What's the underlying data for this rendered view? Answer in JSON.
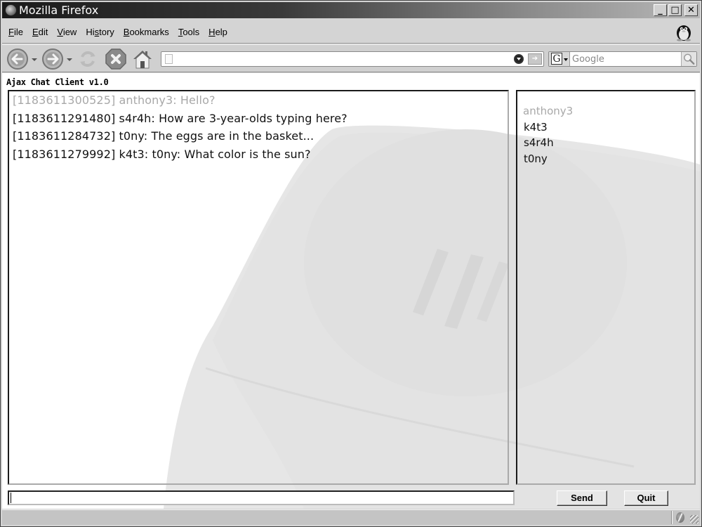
{
  "window": {
    "title": "Mozilla Firefox",
    "controls": {
      "minimize": "_",
      "maximize": "□",
      "close": "✕"
    }
  },
  "menubar": {
    "items": [
      {
        "label": "File",
        "accel": "F"
      },
      {
        "label": "Edit",
        "accel": "E"
      },
      {
        "label": "View",
        "accel": "V"
      },
      {
        "label": "History",
        "accel": "s"
      },
      {
        "label": "Bookmarks",
        "accel": "B"
      },
      {
        "label": "Tools",
        "accel": "T"
      },
      {
        "label": "Help",
        "accel": "H"
      }
    ]
  },
  "navbar": {
    "icons": [
      "back-icon",
      "forward-icon",
      "reload-icon",
      "stop-icon",
      "home-icon"
    ],
    "url_value": "",
    "search_placeholder": "Google",
    "search_engine_letter": "G"
  },
  "app": {
    "title": "Ajax Chat Client v1.0",
    "messages": [
      {
        "timestamp": "[1183611300525]",
        "user": "anthony3",
        "text": "Hello?",
        "self": true,
        "line": "[1183611300525] anthony3: Hello?"
      },
      {
        "timestamp": "[1183611291480]",
        "user": "s4r4h",
        "text": "How are 3-year-olds typing here?",
        "self": false,
        "line": "[1183611291480] s4r4h: How are 3-year-olds typing here?"
      },
      {
        "timestamp": "[1183611284732]",
        "user": "t0ny",
        "text": "The eggs are in the basket...",
        "self": false,
        "line": "[1183611284732] t0ny: The eggs are in the basket..."
      },
      {
        "timestamp": "[1183611279992]",
        "user": "k4t3",
        "text": "t0ny: What color is the sun?",
        "self": false,
        "line": "[1183611279992] k4t3: t0ny: What color is the sun?"
      }
    ],
    "users": [
      {
        "name": "anthony3",
        "self": true
      },
      {
        "name": "k4t3",
        "self": false
      },
      {
        "name": "s4r4h",
        "self": false
      },
      {
        "name": "t0ny",
        "self": false
      }
    ],
    "input_value": "",
    "send_label": "Send",
    "quit_label": "Quit"
  },
  "statusbar": {
    "text": ""
  }
}
